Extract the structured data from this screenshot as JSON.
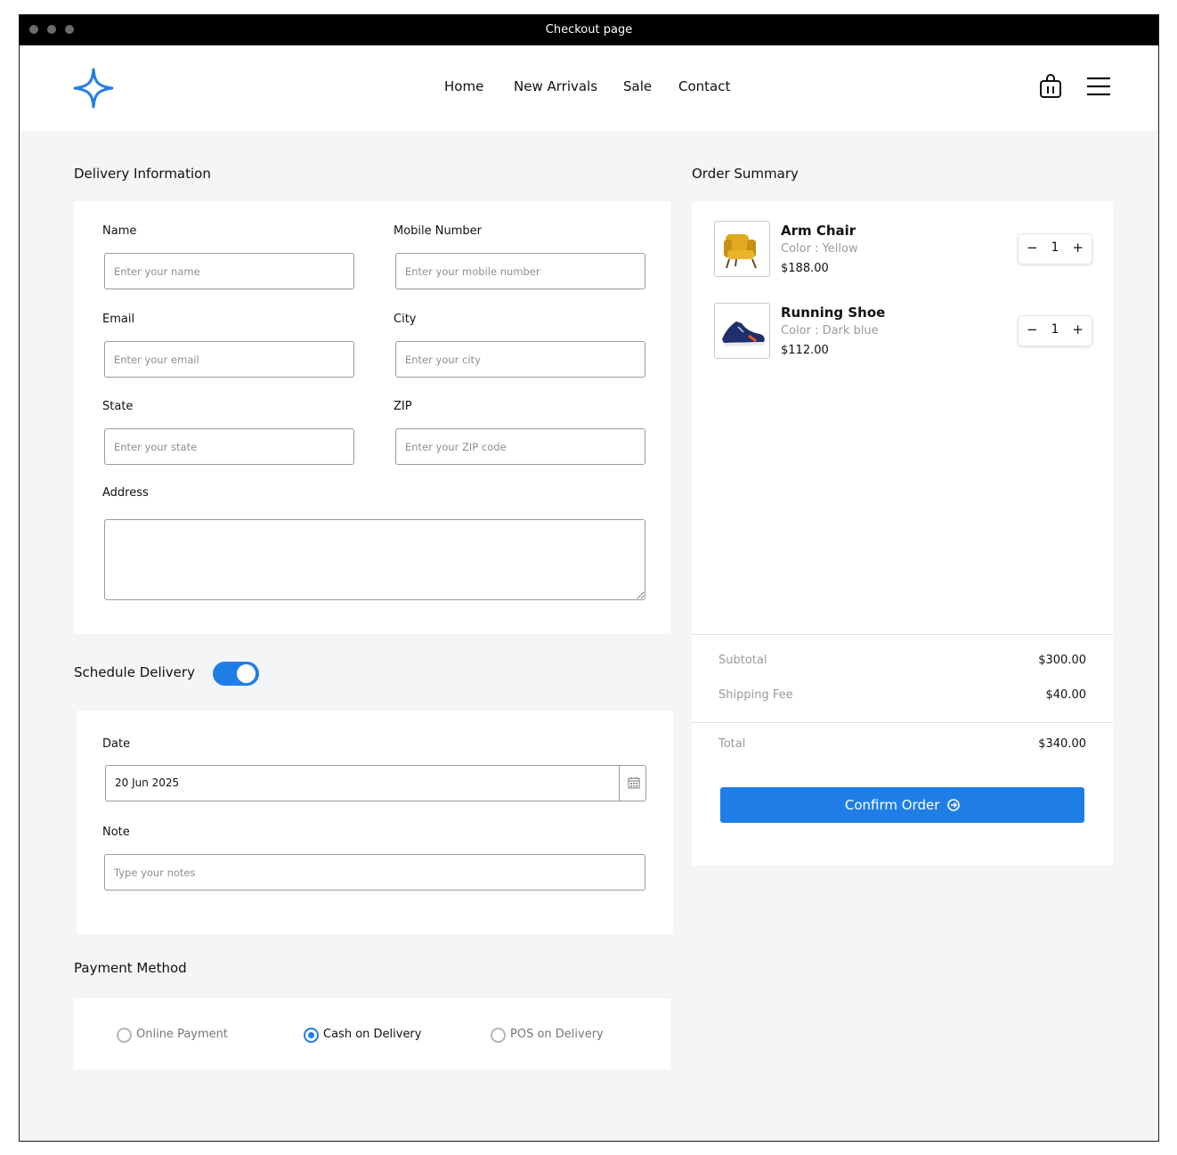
{
  "window": {
    "title": "Checkout page"
  },
  "nav": {
    "links": [
      "Home",
      "New Arrivals",
      "Sale",
      "Contact"
    ],
    "logo_icon": "sparkle-star-icon",
    "cart_icon": "shopping-bag-icon",
    "menu_icon": "hamburger-menu-icon"
  },
  "delivery": {
    "title": "Delivery Information",
    "fields": {
      "name": {
        "label": "Name",
        "placeholder": "Enter your name"
      },
      "mobile": {
        "label": "Mobile Number",
        "placeholder": "Enter your mobile number"
      },
      "email": {
        "label": "Email",
        "placeholder": "Enter your email"
      },
      "city": {
        "label": "City",
        "placeholder": "Enter your city"
      },
      "state": {
        "label": "State",
        "placeholder": "Enter your state"
      },
      "zip": {
        "label": "ZIP",
        "placeholder": "Enter your ZIP code"
      },
      "address": {
        "label": "Address",
        "placeholder": ""
      }
    }
  },
  "schedule": {
    "title": "Schedule Delivery",
    "enabled": true,
    "date_label": "Date",
    "date_value": "20 Jun 2025",
    "note_label": "Note",
    "note_placeholder": "Type your notes"
  },
  "payment": {
    "title": "Payment Method",
    "options": [
      "Online Payment",
      "Cash on Delivery",
      "POS on Delivery"
    ],
    "selected": "Cash on Delivery"
  },
  "summary": {
    "title": "Order Summary",
    "items": [
      {
        "name": "Arm Chair",
        "color": "Color : Yellow",
        "price": "$188.00",
        "qty": "1"
      },
      {
        "name": "Running Shoe",
        "color": "Color : Dark blue",
        "price": "$112.00",
        "qty": "1"
      }
    ],
    "subtotal_label": "Subtotal",
    "subtotal_value": "$300.00",
    "shipping_label": "Shipping Fee",
    "shipping_value": "$40.00",
    "total_label": "Total",
    "total_value": "$340.00",
    "confirm_label": "Confirm Order"
  },
  "colors": {
    "accent": "#1f7ee6",
    "background": "#f4f5f7",
    "titlebar": "#000000"
  }
}
